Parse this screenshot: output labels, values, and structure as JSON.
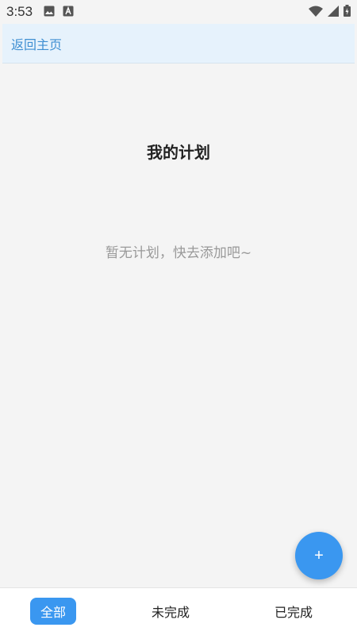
{
  "status_bar": {
    "time": "3:53",
    "icons": [
      "image-icon",
      "app-icon",
      "wifi-icon",
      "signal-icon",
      "battery-icon"
    ]
  },
  "header": {
    "back_label": "返回主页"
  },
  "main": {
    "title": "我的计划",
    "empty_message": "暂无计划，快去添加吧~"
  },
  "fab": {
    "label": "+"
  },
  "tabs": [
    {
      "label": "全部",
      "active": true
    },
    {
      "label": "未完成",
      "active": false
    },
    {
      "label": "已完成",
      "active": false
    }
  ],
  "colors": {
    "accent": "#3a97f0",
    "link": "#3f8fd2",
    "header_bg": "#e6f2fc",
    "page_bg": "#f4f4f4"
  }
}
